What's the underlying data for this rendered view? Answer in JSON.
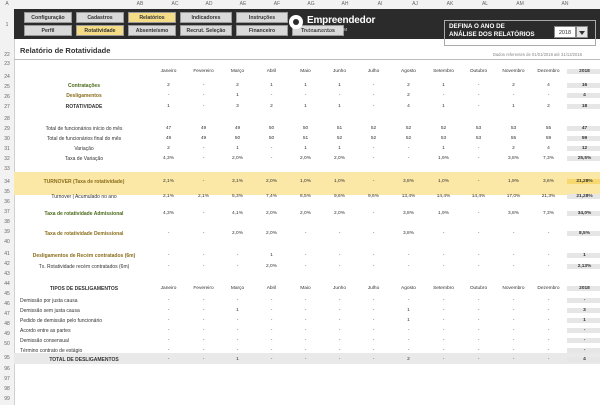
{
  "column_headers": [
    "A",
    "AB",
    "AC",
    "AD",
    "AE",
    "AF",
    "AG",
    "AH",
    "AI",
    "AJ",
    "AK",
    "AL",
    "AM",
    "AN"
  ],
  "row_numbers": [
    "1",
    "22",
    "23",
    "24",
    "25",
    "26",
    "27",
    "28",
    "29",
    "30",
    "31",
    "32",
    "33",
    "34",
    "35",
    "36",
    "37",
    "38",
    "39",
    "40",
    "41",
    "42",
    "43",
    "44",
    "45",
    "46",
    "47",
    "48",
    "49",
    "50",
    "95",
    "96",
    "97",
    "98",
    "99"
  ],
  "nav": {
    "row1": [
      "Configuração",
      "Cadastros",
      "Relatórios",
      "Indicadores",
      "Instruções"
    ],
    "row2": [
      "Perfil",
      "Rotatividade",
      "Absenteísmo",
      "Recrut. Seleção",
      "Financeiro",
      "Treinamentos"
    ],
    "active1": "Relatórios",
    "active2": "Rotatividade"
  },
  "logo": {
    "name": "Empreendedor",
    "sub": "CURSOS.COM"
  },
  "year_selector": {
    "label_line1": "DEFINA O ANO DE",
    "label_line2": "ANÁLISE DOS RELATÓRIOS",
    "value": "2018"
  },
  "report": {
    "title": "Relatório de Rotatividade",
    "note": "Dados referentes de 01/01/2018 até 31/12/2018",
    "months": [
      "Janeiro",
      "Fevereiro",
      "Março",
      "Abril",
      "Maio",
      "Junho",
      "Julho",
      "Agosto",
      "Setembro",
      "Outubro",
      "Novembro",
      "Dezembro",
      "2018"
    ]
  },
  "rows": [
    {
      "label": "Contratações",
      "vals": [
        "2",
        "-",
        "2",
        "1",
        "1",
        "1",
        "-",
        "2",
        "1",
        "-",
        "2",
        "4",
        "16"
      ]
    },
    {
      "label": "Desligamentos",
      "vals": [
        "-",
        "-",
        "1",
        "-",
        "-",
        "-",
        "-",
        "2",
        "-",
        "-",
        "-",
        "-",
        "4"
      ]
    },
    {
      "label": "ROTATIVIDADE",
      "vals": [
        "1",
        "-",
        "3",
        "2",
        "1",
        "1",
        "-",
        "4",
        "1",
        "-",
        "1",
        "2",
        "18"
      ]
    },
    {
      "label": "Total de funcionários início do mês",
      "vals": [
        "47",
        "49",
        "49",
        "50",
        "50",
        "51",
        "52",
        "52",
        "52",
        "53",
        "53",
        "55",
        "47"
      ]
    },
    {
      "label": "Total de funcionários final do mês",
      "vals": [
        "49",
        "49",
        "50",
        "50",
        "51",
        "52",
        "52",
        "52",
        "53",
        "53",
        "55",
        "59",
        "59"
      ]
    },
    {
      "label": "Variação",
      "vals": [
        "2",
        "-",
        "1",
        "-",
        "1",
        "1",
        "-",
        "-",
        "1",
        "-",
        "2",
        "4",
        "12"
      ]
    },
    {
      "label": "Taxa de Variação",
      "vals": [
        "4,3%",
        "-",
        "2,0%",
        "-",
        "2,0%",
        "2,0%",
        "-",
        "-",
        "1,9%",
        "-",
        "3,8%",
        "7,3%",
        "25,5%"
      ]
    },
    {
      "label": "TURNOVER (Taxa de rotatividade)",
      "vals": [
        "2,1%",
        "-",
        "3,1%",
        "2,0%",
        "1,0%",
        "1,0%",
        "-",
        "3,8%",
        "1,0%",
        "-",
        "1,9%",
        "3,6%",
        "21,28%"
      ]
    },
    {
      "label": "Turnover | Acumulado no ano",
      "vals": [
        "2,1%",
        "2,1%",
        "5,3%",
        "7,4%",
        "8,5%",
        "9,6%",
        "9,6%",
        "13,4%",
        "14,4%",
        "14,4%",
        "17,0%",
        "21,3%",
        "21,28%"
      ]
    },
    {
      "label": "Taxa de rotatividade Admissional",
      "vals": [
        "4,3%",
        "-",
        "4,1%",
        "2,0%",
        "2,0%",
        "2,0%",
        "-",
        "3,8%",
        "1,9%",
        "-",
        "3,8%",
        "7,3%",
        "34,0%"
      ]
    },
    {
      "label": "Taxa de rotatividade Demissional",
      "vals": [
        "-",
        "-",
        "2,0%",
        "2,0%",
        "-",
        "-",
        "-",
        "3,8%",
        "-",
        "-",
        "-",
        "-",
        "8,5%"
      ]
    },
    {
      "label": "Desligamentos de Recém contratados (6m)",
      "vals": [
        "-",
        "-",
        "-",
        "1",
        "-",
        "-",
        "-",
        "-",
        "-",
        "-",
        "-",
        "-",
        "1"
      ]
    },
    {
      "label": "Tx. Rotatividade recém contratados (6m)",
      "vals": [
        "-",
        "-",
        "-",
        "2,0%",
        "-",
        "-",
        "-",
        "-",
        "-",
        "-",
        "-",
        "-",
        "2,13%"
      ]
    },
    {
      "label": "TIPOS DE DESLIGAMENTOS",
      "vals": [
        "Janeiro",
        "Fevereiro",
        "Março",
        "Abril",
        "Maio",
        "Junho",
        "Julho",
        "Agosto",
        "Setembro",
        "Outubro",
        "Novembro",
        "Dezembro",
        "2018"
      ]
    },
    {
      "label": "Demissão por justa causa",
      "vals": [
        "-",
        "-",
        "-",
        "-",
        "-",
        "-",
        "-",
        "-",
        "-",
        "-",
        "-",
        "-",
        "-"
      ]
    },
    {
      "label": "Demissão sem justa causa",
      "vals": [
        "-",
        "-",
        "1",
        "-",
        "-",
        "-",
        "-",
        "1",
        "-",
        "-",
        "-",
        "-",
        "3"
      ]
    },
    {
      "label": "Pedido de demissão pelo funcionário",
      "vals": [
        "-",
        "-",
        "-",
        "-",
        "-",
        "-",
        "-",
        "1",
        "-",
        "-",
        "-",
        "-",
        "1"
      ]
    },
    {
      "label": "Acordo entre as partes",
      "vals": [
        "-",
        "-",
        "-",
        "-",
        "-",
        "-",
        "-",
        "-",
        "-",
        "-",
        "-",
        "-",
        "-"
      ]
    },
    {
      "label": "Demissão consensual",
      "vals": [
        "-",
        "-",
        "-",
        "-",
        "-",
        "-",
        "-",
        "-",
        "-",
        "-",
        "-",
        "-",
        "-"
      ]
    },
    {
      "label": "Término contrato de estágio",
      "vals": [
        "-",
        "-",
        "-",
        "-",
        "-",
        "-",
        "-",
        "-",
        "-",
        "-",
        "-",
        "-",
        "-"
      ]
    },
    {
      "label": "TOTAL DE DESLIGAMENTOS",
      "vals": [
        "-",
        "-",
        "1",
        "-",
        "-",
        "-",
        "-",
        "2",
        "-",
        "-",
        "-",
        "-",
        "4"
      ]
    }
  ],
  "colors": {
    "accent_yellow": "#fbe7a6",
    "gold_text": "#8a6d1b",
    "green_text": "#4a6a1a",
    "dark_bar": "#2b2b2b"
  }
}
